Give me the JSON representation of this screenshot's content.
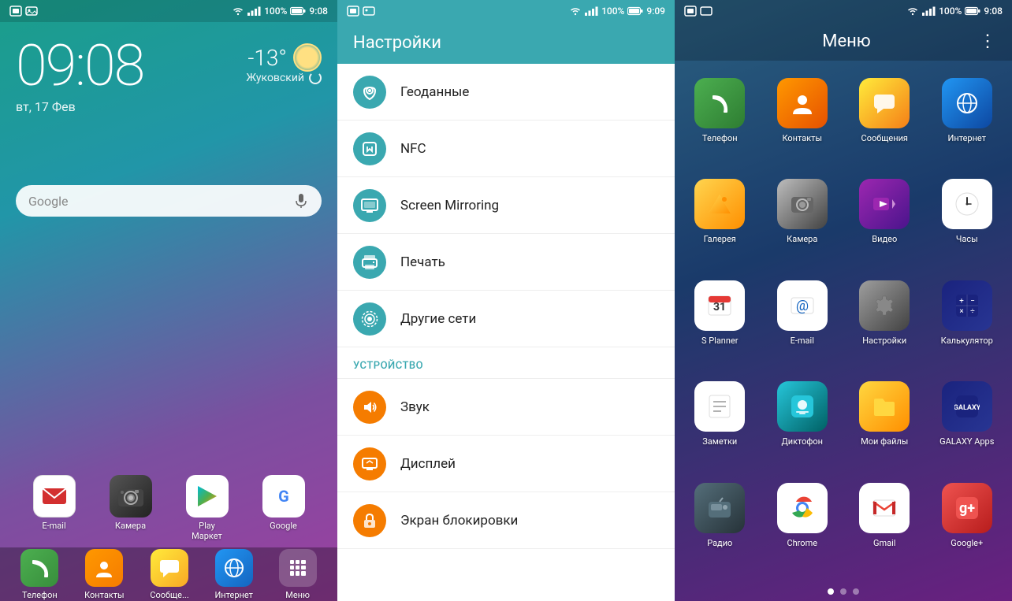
{
  "panel1": {
    "status_time": "9:08",
    "status_battery": "100%",
    "clock": "09:08",
    "date": "вт, 17 Фев",
    "temperature": "-13°",
    "city": "Жуковский",
    "search_placeholder": "Google",
    "dock_apps": [
      {
        "id": "email",
        "label": "E-mail",
        "icon": "✉"
      },
      {
        "id": "camera",
        "label": "Камера",
        "icon": "📷"
      },
      {
        "id": "playmarket",
        "label": "Play\nМаркет",
        "icon": "▶"
      },
      {
        "id": "google",
        "label": "Google",
        "icon": "G"
      }
    ],
    "bottom_apps": [
      {
        "id": "phone",
        "label": "Телефон",
        "icon": "📞"
      },
      {
        "id": "contacts",
        "label": "Контакты",
        "icon": "👤"
      },
      {
        "id": "messages",
        "label": "Сообще...",
        "icon": "✉"
      },
      {
        "id": "internet",
        "label": "Интернет",
        "icon": "🌐"
      },
      {
        "id": "menu",
        "label": "Меню",
        "icon": "⊞"
      }
    ]
  },
  "panel2": {
    "status_time": "9:09",
    "status_battery": "100%",
    "title": "Настройки",
    "items": [
      {
        "id": "geodata",
        "label": "Геоданные",
        "icon": "📍",
        "color": "teal"
      },
      {
        "id": "nfc",
        "label": "NFC",
        "icon": "📲",
        "color": "teal"
      },
      {
        "id": "screen_mirroring",
        "label": "Screen Mirroring",
        "icon": "📺",
        "color": "teal"
      },
      {
        "id": "print",
        "label": "Печать",
        "icon": "🖨",
        "color": "teal"
      },
      {
        "id": "other_networks",
        "label": "Другие сети",
        "icon": "📡",
        "color": "teal"
      }
    ],
    "section_device": "УСТРОЙСТВО",
    "device_items": [
      {
        "id": "sound",
        "label": "Звук",
        "icon": "🔊",
        "color": "orange"
      },
      {
        "id": "display",
        "label": "Дисплей",
        "icon": "🖥",
        "color": "orange"
      },
      {
        "id": "lockscreen",
        "label": "Экран блокировки",
        "icon": "🔒",
        "color": "orange"
      }
    ]
  },
  "panel3": {
    "status_time": "9:08",
    "status_battery": "100%",
    "title": "Меню",
    "apps": [
      {
        "id": "phone",
        "label": "Телефон",
        "icon": "phone"
      },
      {
        "id": "contacts",
        "label": "Контакты",
        "icon": "contacts"
      },
      {
        "id": "messages",
        "label": "Сообщения",
        "icon": "messages"
      },
      {
        "id": "internet",
        "label": "Интернет",
        "icon": "internet"
      },
      {
        "id": "gallery",
        "label": "Галерея",
        "icon": "gallery"
      },
      {
        "id": "camera",
        "label": "Камера",
        "icon": "camera"
      },
      {
        "id": "video",
        "label": "Видео",
        "icon": "video"
      },
      {
        "id": "clock",
        "label": "Часы",
        "icon": "clock"
      },
      {
        "id": "splanner",
        "label": "S Planner",
        "icon": "splanner"
      },
      {
        "id": "email",
        "label": "E-mail",
        "icon": "email2"
      },
      {
        "id": "settings",
        "label": "Настройки",
        "icon": "settings"
      },
      {
        "id": "calculator",
        "label": "Калькулятор",
        "icon": "calc"
      },
      {
        "id": "notes",
        "label": "Заметки",
        "icon": "notes"
      },
      {
        "id": "recorder",
        "label": "Диктофон",
        "icon": "recorder"
      },
      {
        "id": "myfiles",
        "label": "Мои файлы",
        "icon": "myfiles"
      },
      {
        "id": "galaxyapps",
        "label": "GALAXY Apps",
        "icon": "galaxyapps"
      },
      {
        "id": "radio",
        "label": "Радио",
        "icon": "radio"
      },
      {
        "id": "chrome",
        "label": "Chrome",
        "icon": "chrome"
      },
      {
        "id": "gmail",
        "label": "Gmail",
        "icon": "gmail"
      },
      {
        "id": "googleplus",
        "label": "Google+",
        "icon": "googleplus"
      }
    ]
  },
  "icons": {
    "signal": "▌▌▌▌",
    "wifi": "wifi",
    "battery": "100%",
    "more_vert": "⋮"
  }
}
